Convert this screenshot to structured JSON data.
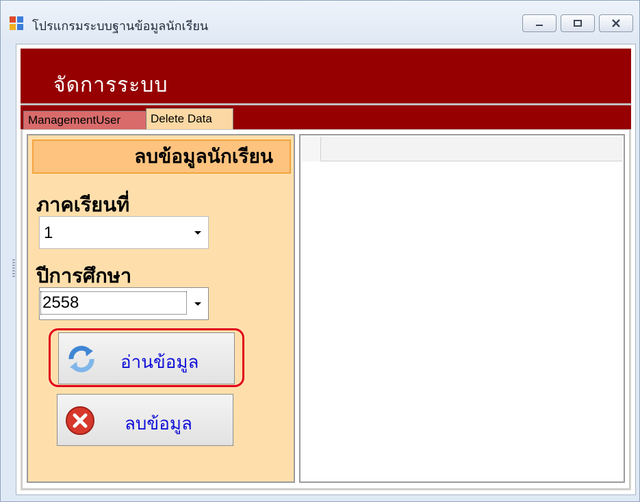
{
  "window": {
    "title": "โปรแกรมระบบฐานข้อมูลนักเรียน"
  },
  "header": {
    "title": "จัดการระบบ"
  },
  "tabs": [
    {
      "label": "ManagementUser",
      "active": false
    },
    {
      "label": "Delete Data",
      "active": true
    }
  ],
  "panel": {
    "title": "ลบข้อมูลนักเรียน",
    "term_label": "ภาคเรียนที่",
    "term_value": "1",
    "year_label": "ปีการศึกษา",
    "year_value": "2558",
    "read_button": "อ่านข้อมูล",
    "delete_button": "ลบข้อมูล"
  },
  "colors": {
    "header_red": "#960000",
    "panel_bg": "#fedfac",
    "panel_title_bg": "#fdc37f",
    "button_text": "#1010d8",
    "highlight": "#e0001a"
  },
  "icons": {
    "app": "app-icon",
    "read": "refresh-icon",
    "delete": "delete-x-icon"
  }
}
